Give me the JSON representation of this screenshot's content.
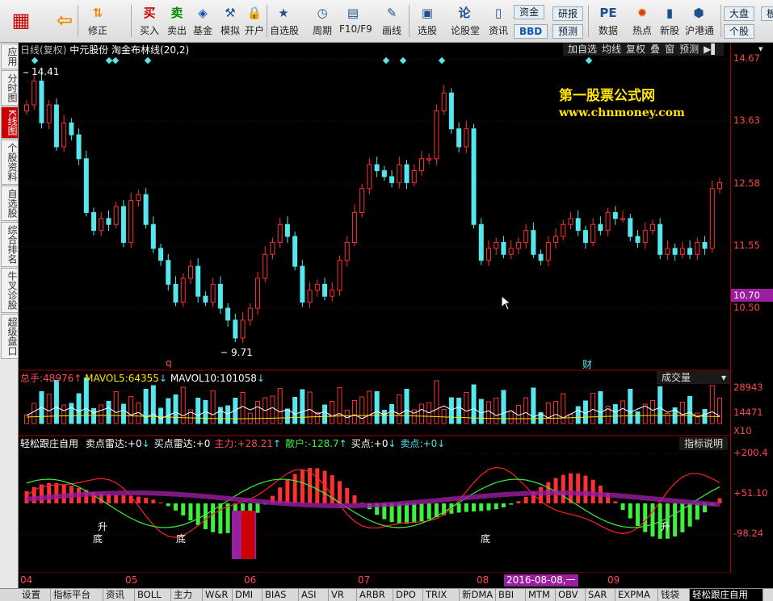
{
  "toolbar": {
    "items": [
      {
        "label": "",
        "icon": "logo-icon"
      },
      {
        "label": "",
        "icon": "back-arrow-icon"
      },
      {
        "label": "修正",
        "icon": "up-down-arrow-icon"
      },
      {
        "label": "买入",
        "icon": "buy-icon",
        "glyph": "买"
      },
      {
        "label": "卖出",
        "icon": "sell-icon",
        "glyph": "卖"
      },
      {
        "label": "基金",
        "icon": "fund-icon"
      },
      {
        "label": "模拟",
        "icon": "hammer-icon"
      },
      {
        "label": "开户",
        "icon": "lock-icon"
      },
      {
        "label": "自选股",
        "icon": "star-icon"
      },
      {
        "label": "周期",
        "icon": "clock-icon"
      },
      {
        "label": "F10/F9",
        "icon": "f10-icon"
      },
      {
        "label": "画线",
        "icon": "pen-icon"
      },
      {
        "label": "选股",
        "icon": "select-stock-icon"
      },
      {
        "label": "论股堂",
        "icon": "forum-icon",
        "glyph": "论"
      },
      {
        "label": "资讯",
        "icon": "news-icon"
      },
      {
        "label": "数据",
        "icon": "pe-icon",
        "glyph": "PE"
      },
      {
        "label": "热点",
        "icon": "hot-icon"
      },
      {
        "label": "新股",
        "icon": "new-stock-icon"
      },
      {
        "label": "沪港通",
        "icon": "sse-hkex-icon"
      }
    ],
    "pills": {
      "funds": "资金",
      "bbd": "BBD",
      "research": "研报",
      "forecast": "预测",
      "market": "大盘",
      "single": "个股",
      "board": "板"
    }
  },
  "sidebar": [
    "应用",
    "分时图",
    "K线图",
    "个股资料",
    "自选股",
    "综合排名",
    "牛叉诊股",
    "超级盘口"
  ],
  "chart_header": {
    "line_type": "日线(复权)",
    "stock": "中元股份",
    "indicator": "淘金布林线(20,2)",
    "buttons": [
      "加自选",
      "均线",
      "复权",
      "叠",
      "窗",
      "预测"
    ]
  },
  "watermark": {
    "title": "第一股票公式网",
    "url": "www.chnmoney.com"
  },
  "price_axis": {
    "ticks": [
      "14.67",
      "13.63",
      "12.58",
      "11.55",
      "10.50"
    ],
    "current": "10.70"
  },
  "annotations": {
    "high": "14.41",
    "low": "9.71",
    "marker_q": "q",
    "marker_cai": "财"
  },
  "volume_header": {
    "total_label": "总手:",
    "total": "48976",
    "total_arrow": "↑",
    "mavol5_label": "MAVOL5:",
    "mavol5": "64355",
    "mavol5_arrow": "↓",
    "mavol10_label": "MAVOL10:",
    "mavol10": "101058",
    "mavol10_arrow": "↓",
    "selector": "成交量",
    "ticks": [
      "28943",
      "14471",
      "X10"
    ]
  },
  "indicator_header": {
    "name": "轻松跟庄自用",
    "items": [
      {
        "label": "卖点雷达:",
        "value": "+0",
        "arrow": "↓",
        "color": "wht"
      },
      {
        "label": "买点雷达:",
        "value": "+0",
        "arrow": "",
        "color": "wht"
      },
      {
        "label": "主力:",
        "value": "+28.21",
        "arrow": "↑",
        "color": "red"
      },
      {
        "label": "散户:",
        "value": "-128.7",
        "arrow": "↑",
        "color": "grn"
      },
      {
        "label": "买点:",
        "value": "+0",
        "arrow": "↓",
        "color": "wht"
      },
      {
        "label": "卖点:",
        "value": "+0",
        "arrow": "↓",
        "color": "cyan"
      }
    ],
    "help": "指标说明",
    "ticks": [
      "+200.4",
      "+51.10",
      "-98.24"
    ]
  },
  "indicator_marks": {
    "di": "底",
    "sheng": "升"
  },
  "x_axis": {
    "months": [
      "04",
      "05",
      "06",
      "07",
      "08",
      "09"
    ],
    "cursor_date": "2016-08-08,一"
  },
  "bottom_tabs": [
    "设置",
    "指标平台",
    "资讯",
    "BOLL",
    "主力",
    "W&R",
    "DMI",
    "BIAS",
    "ASI",
    "VR",
    "ARBR",
    "DPO",
    "TRIX",
    "新DMA",
    "BBI",
    "MTM",
    "OBV",
    "SAR",
    "EXPMA",
    "钱袋",
    "轻松跟庄自用"
  ],
  "colors": {
    "up": "#ff3030",
    "down": "#55e6ee",
    "axis": "#a00000",
    "highlight": "#9a1ea0"
  }
}
